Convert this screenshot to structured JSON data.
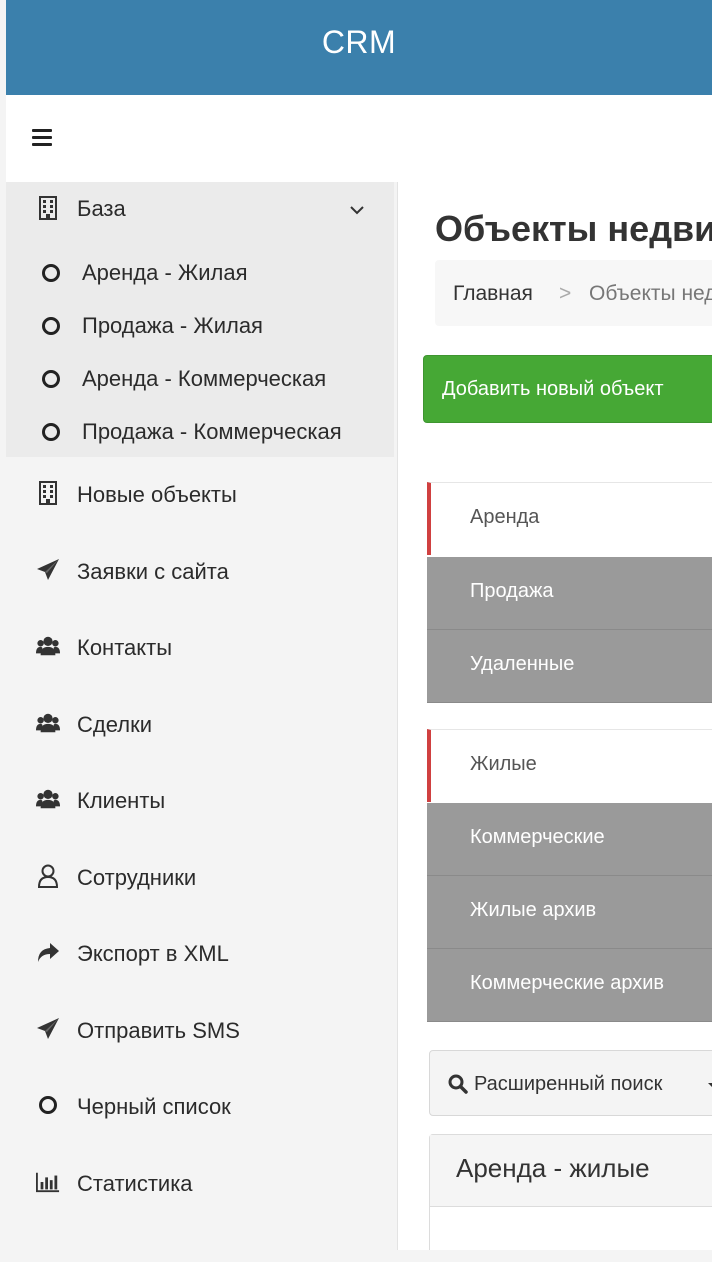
{
  "header": {
    "brand": "CRM"
  },
  "toolbar": {
    "menu_toggle": "menu"
  },
  "sidebar": {
    "group": {
      "label": "База",
      "items": [
        {
          "label": "Аренда - Жилая"
        },
        {
          "label": "Продажа - Жилая"
        },
        {
          "label": "Аренда - Коммерческая"
        },
        {
          "label": "Продажа - Коммерческая"
        }
      ]
    },
    "items": [
      {
        "label": "Новые объекты",
        "icon": "building-icon"
      },
      {
        "label": "Заявки с сайта",
        "icon": "paper-plane-icon"
      },
      {
        "label": "Контакты",
        "icon": "users-icon"
      },
      {
        "label": "Сделки",
        "icon": "users-icon"
      },
      {
        "label": "Клиенты",
        "icon": "users-icon"
      },
      {
        "label": "Сотрудники",
        "icon": "user-outline-icon"
      },
      {
        "label": "Экспорт в XML",
        "icon": "share-icon"
      },
      {
        "label": "Отправить SMS",
        "icon": "paper-plane-icon"
      },
      {
        "label": "Черный список",
        "icon": "circle-outline-icon"
      },
      {
        "label": "Статистика",
        "icon": "bar-chart-icon"
      }
    ]
  },
  "main": {
    "title": "Объекты недвижимости",
    "breadcrumb": {
      "home": "Главная",
      "separator": ">",
      "current": "Объекты недвижимости"
    },
    "add_button": "Добавить новый объект",
    "deal_tabs": [
      {
        "label": "Аренда",
        "active": true
      },
      {
        "label": "Продажа",
        "active": false
      },
      {
        "label": "Удаленные",
        "active": false
      }
    ],
    "type_tabs": [
      {
        "label": "Жилые",
        "active": true
      },
      {
        "label": "Коммерческие",
        "active": false
      },
      {
        "label": "Жилые архив",
        "active": false
      },
      {
        "label": "Коммерческие архив",
        "active": false
      }
    ],
    "advanced_search": "Расширенный поиск",
    "panel_title": "Аренда - жилые"
  },
  "colors": {
    "header_bg": "#3b80ac",
    "add_button_bg": "#46a835",
    "active_tab_border": "#d04040",
    "inactive_tab_bg": "#9a9a9a"
  }
}
